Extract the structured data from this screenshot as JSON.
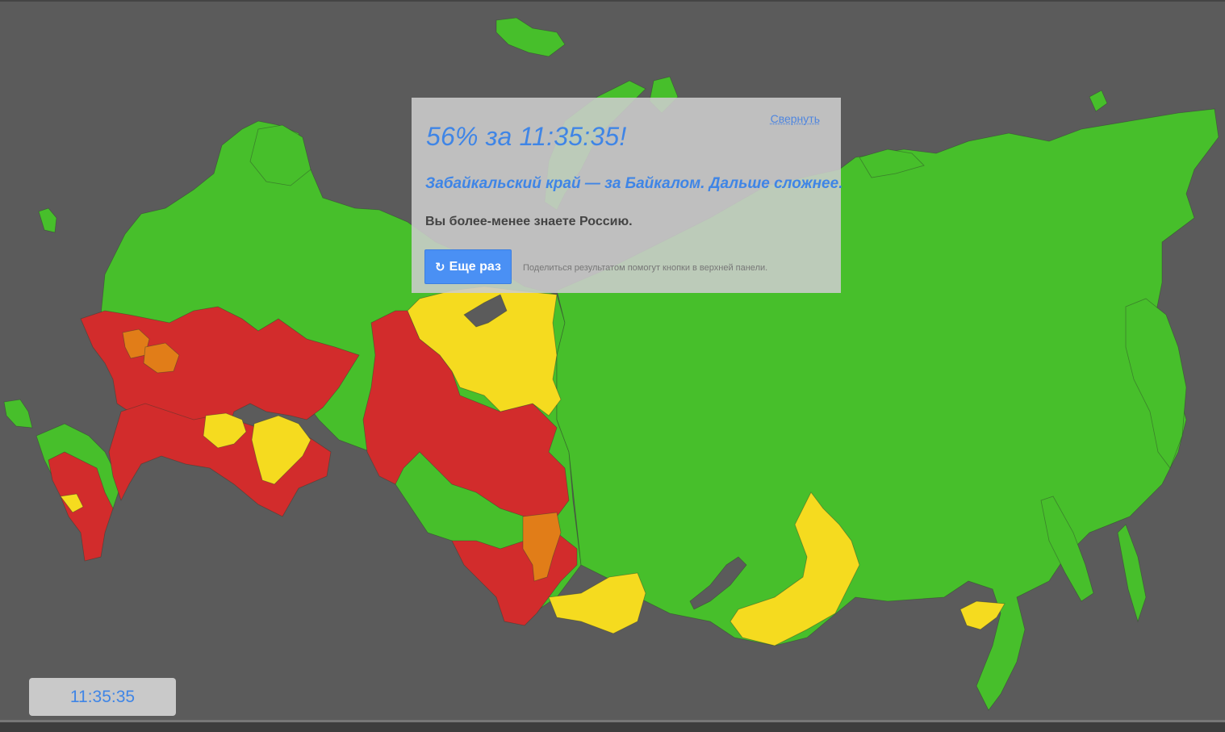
{
  "result": {
    "collapse_label": "Свернуть",
    "score_text": "56% за 11:35:35!",
    "hint_text": "Забайкальский край — за Байкалом. Дальше сложнее.",
    "verdict_text": "Вы более-менее знаете Россию.",
    "retry_label": "Еще раз",
    "retry_icon": "refresh-icon",
    "share_note": "Поделиться результатом помогут кнопки в верхней панели."
  },
  "timer": {
    "value": "11:35:35"
  },
  "colors": {
    "background": "#5b5b5b",
    "correct": "#47bf2b",
    "second_try": "#f5db1f",
    "third_try": "#e17d18",
    "wrong": "#d22c2c",
    "accent": "#3f85e6"
  }
}
